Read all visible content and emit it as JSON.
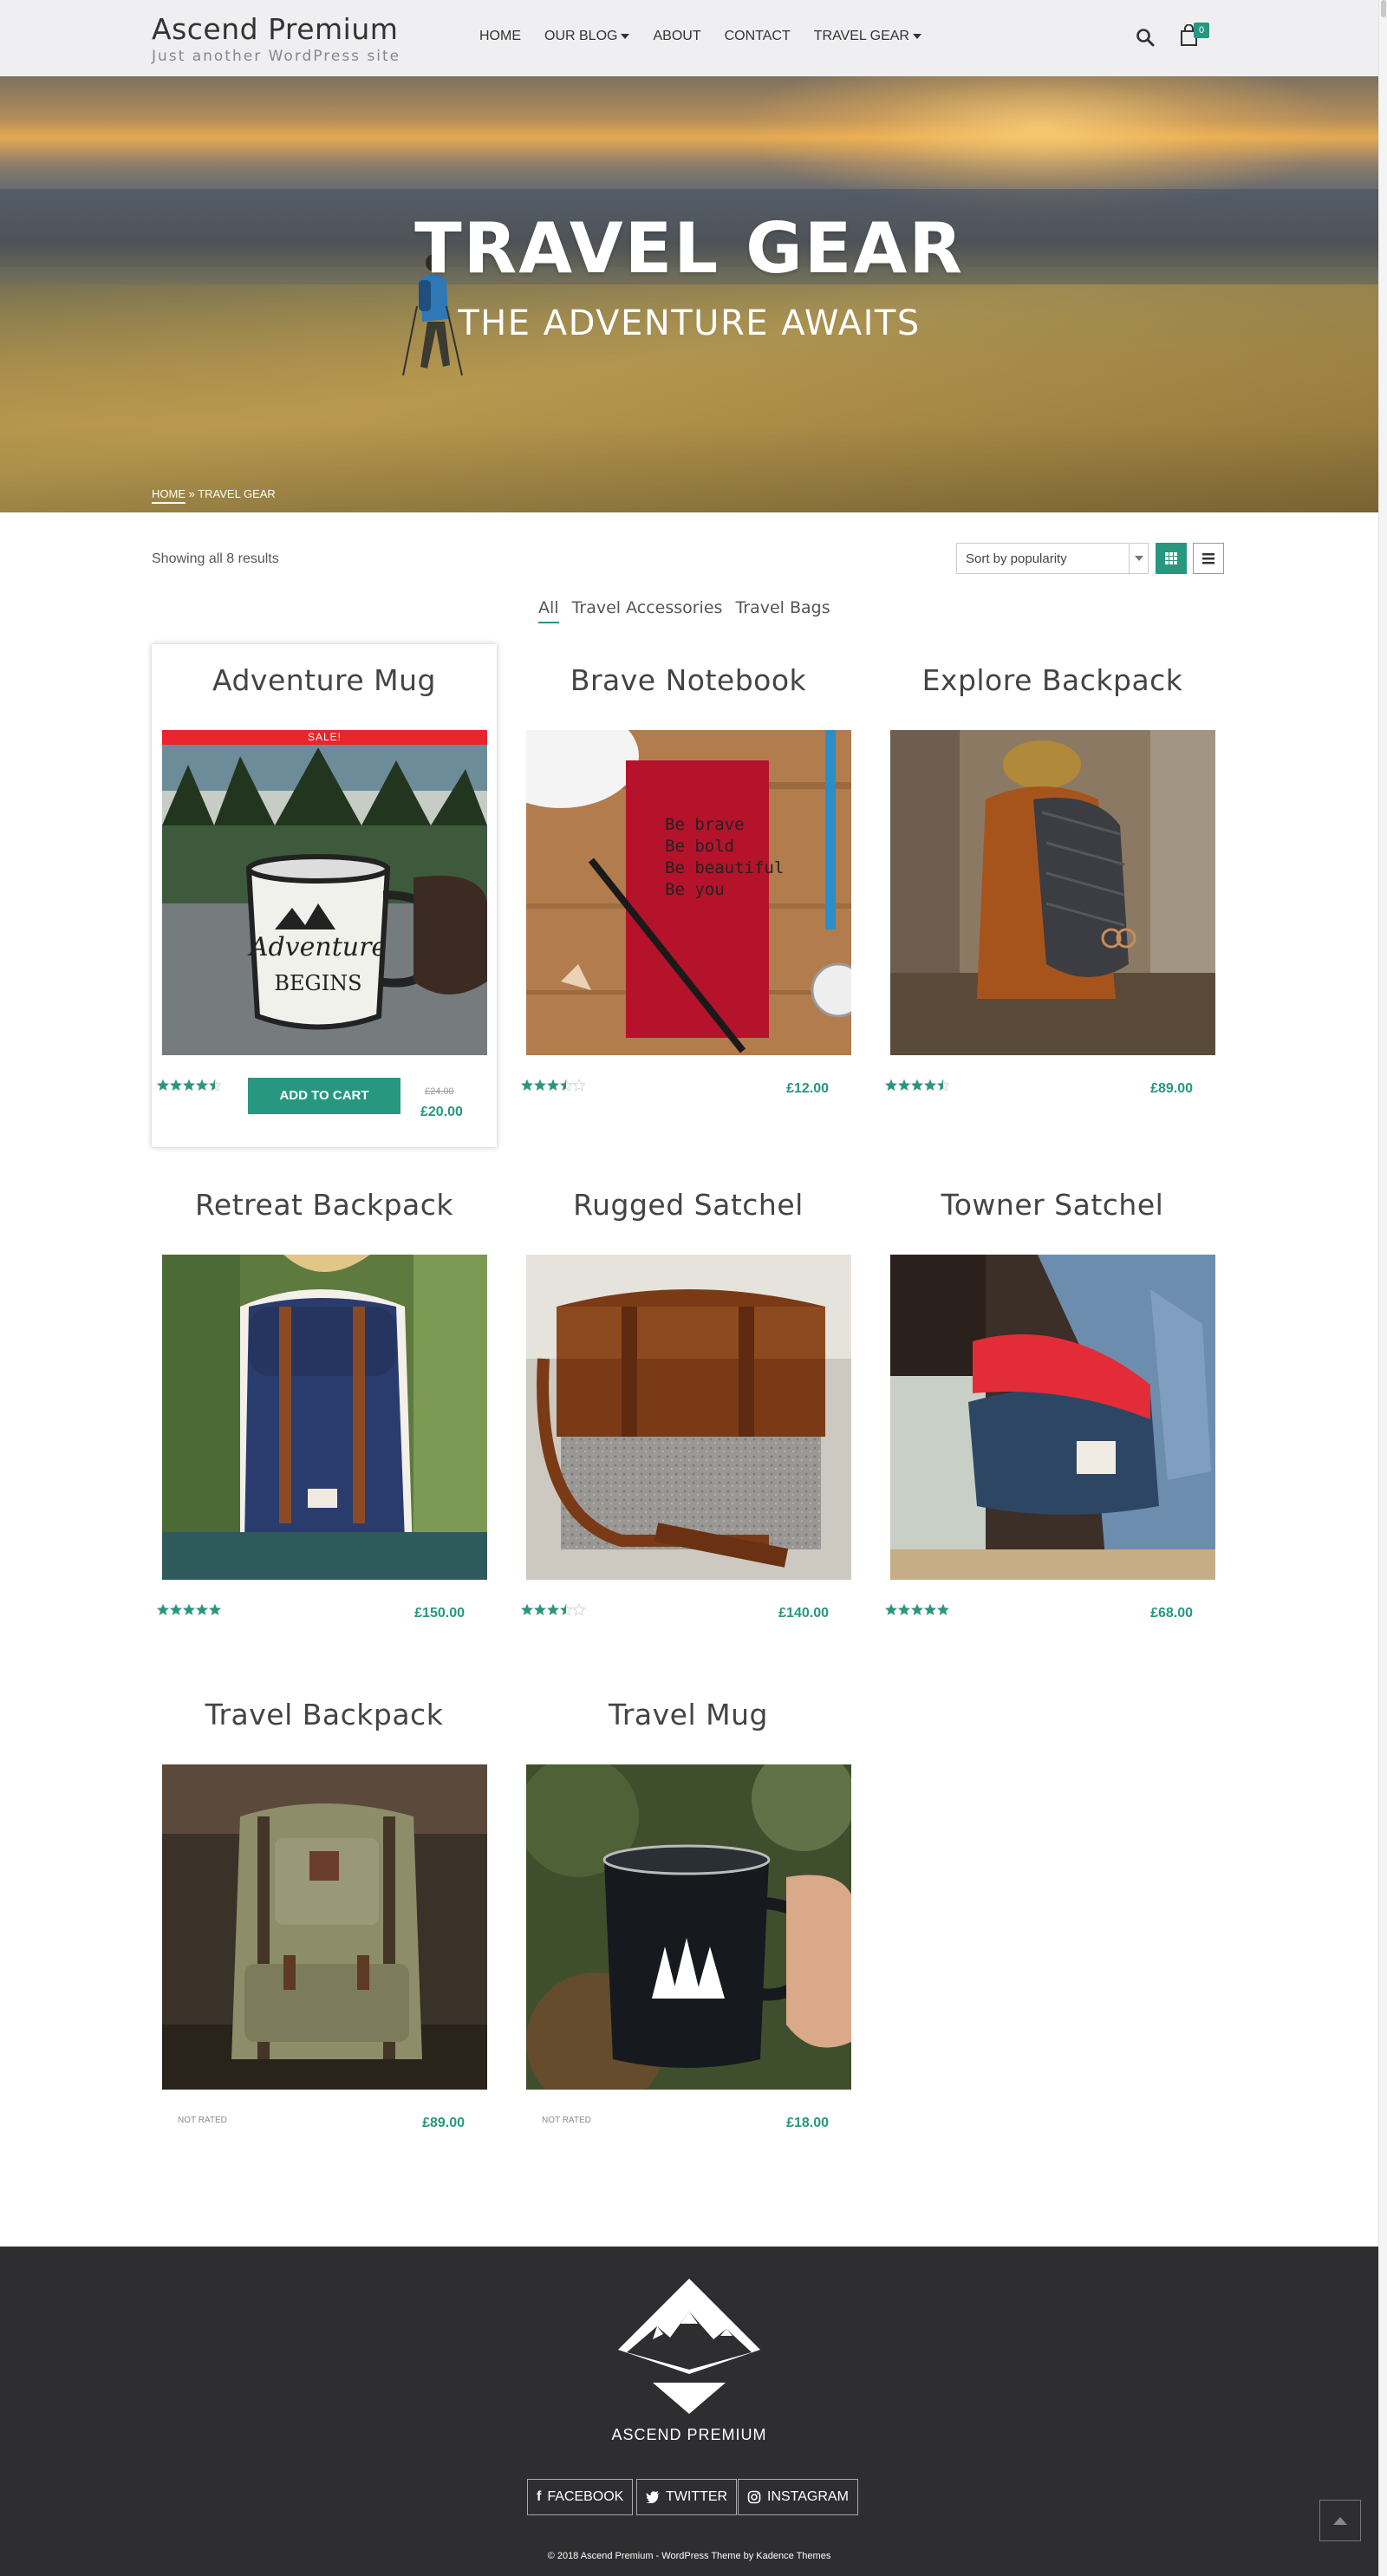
{
  "header": {
    "site_title": "Ascend Premium",
    "tagline": "Just another WordPress site",
    "nav": [
      {
        "label": "HOME",
        "dropdown": false
      },
      {
        "label": "OUR BLOG",
        "dropdown": true
      },
      {
        "label": "ABOUT",
        "dropdown": false
      },
      {
        "label": "CONTACT",
        "dropdown": false
      },
      {
        "label": "TRAVEL GEAR",
        "dropdown": true
      }
    ],
    "cart_count": "0"
  },
  "hero": {
    "title": "TRAVEL GEAR",
    "subtitle": "THE ADVENTURE AWAITS",
    "breadcrumb_home": "HOME",
    "breadcrumb_sep": " » ",
    "breadcrumb_current": "TRAVEL GEAR"
  },
  "shop": {
    "result_count": "Showing all 8 results",
    "sort_selected": "Sort by popularity",
    "filters": [
      "All",
      "Travel Accessories",
      "Travel Bags"
    ],
    "active_filter": "All"
  },
  "products": [
    {
      "name": "Adventure Mug",
      "sale_label": "SALE!",
      "old_price": "£24.00",
      "price": "£20.00",
      "rating": 4.5,
      "button": "ADD TO CART"
    },
    {
      "name": "Brave Notebook",
      "price": "£12.00",
      "rating": 3.5
    },
    {
      "name": "Explore Backpack",
      "price": "£89.00",
      "rating": 4.5
    },
    {
      "name": "Retreat Backpack",
      "price": "£150.00",
      "rating": 5
    },
    {
      "name": "Rugged Satchel",
      "price": "£140.00",
      "rating": 3.5
    },
    {
      "name": "Towner Satchel",
      "price": "£68.00",
      "rating": 5
    },
    {
      "name": "Travel Backpack",
      "price": "£89.00",
      "rating_text": "NOT RATED"
    },
    {
      "name": "Travel Mug",
      "price": "£18.00",
      "rating_text": "NOT RATED"
    }
  ],
  "footer": {
    "brand": "ASCEND PREMIUM",
    "social": [
      "FACEBOOK",
      "TWITTER",
      "INSTAGRAM"
    ],
    "copyright": "© 2018 Ascend Premium - WordPress Theme by Kadence Themes"
  },
  "colors": {
    "accent": "#27977f",
    "sale": "#e8242c",
    "footer_bg": "#2e2e30"
  }
}
